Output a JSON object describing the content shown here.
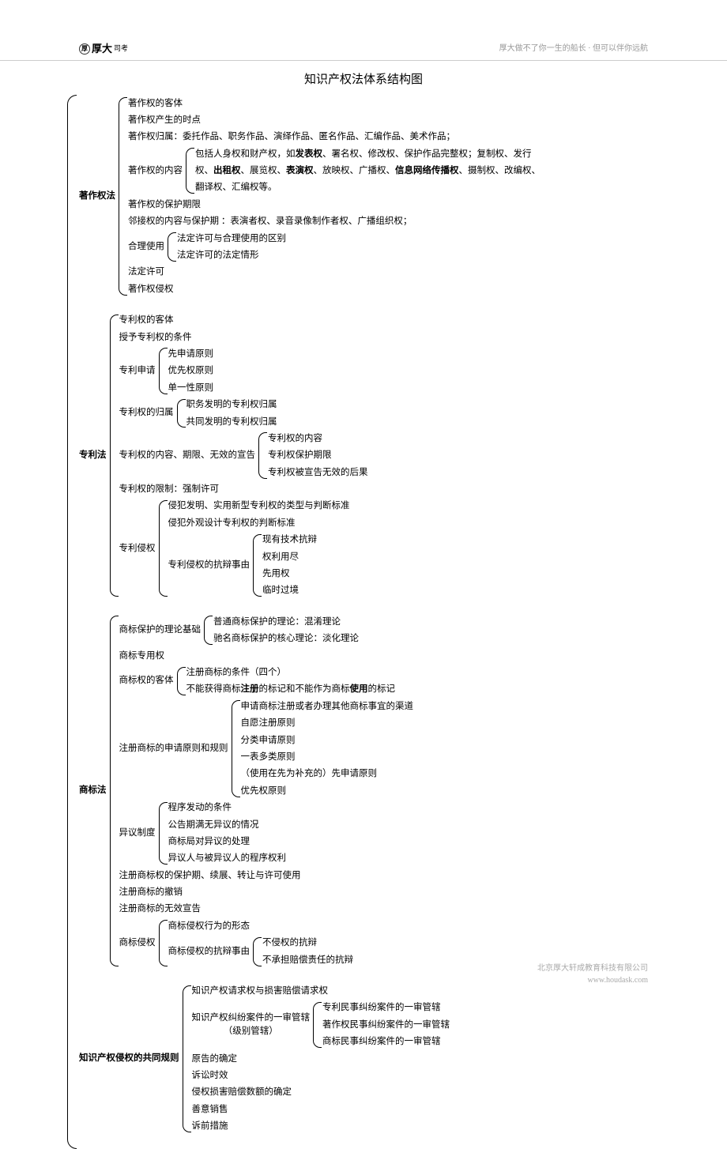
{
  "header": {
    "logo_main": "厚大",
    "logo_sub": "司考",
    "tagline": "厚大做不了你一生的船长 · 但可以伴你远航"
  },
  "title": "知识产权法体系结构图",
  "s1": {
    "label": "著作权法",
    "i1": "著作权的客体",
    "i2": "著作权产生的时点",
    "i3": "著作权归属：委托作品、职务作品、演绎作品、匿名作品、汇编作品、美术作品；",
    "i4_label": "著作权的内容",
    "i4_c1a": "包括人身权和财产权，如",
    "i4_c1b": "发表权",
    "i4_c1c": "、署名权、修改权、保护作品完整权；复制权、发行",
    "i4_c2a": "权、",
    "i4_c2b": "出租权",
    "i4_c2c": "、展览权、",
    "i4_c2d": "表演权",
    "i4_c2e": "、放映权、广播权、",
    "i4_c2f": "信息网络传播权",
    "i4_c2g": "、摄制权、改编权、",
    "i4_c3": "翻译权、汇编权等。",
    "i5": "著作权的保护期限",
    "i6": "邻接权的内容与保护期 ：表演者权、录音录像制作者权、广播组织权；",
    "i7_label": "合理使用",
    "i7_c1": "法定许可与合理使用的区别",
    "i7_c2": "法定许可的法定情形",
    "i8": "法定许可",
    "i9": "著作权侵权"
  },
  "s2": {
    "label": "专利法",
    "i1": "专利权的客体",
    "i2": "授予专利权的条件",
    "i3_label": "专利申请",
    "i3_c1": "先申请原则",
    "i3_c2": "优先权原则",
    "i3_c3": "单一性原则",
    "i4_label": "专利权的归属",
    "i4_c1": "职务发明的专利权归属",
    "i4_c2": "共同发明的专利权归属",
    "i5_label": "专利权的内容、期限、无效的宣告",
    "i5_c1": "专利权的内容",
    "i5_c2": "专利权保护期限",
    "i5_c3": "专利权被宣告无效的后果",
    "i6": "专利权的限制：强制许可",
    "i7_label": "专利侵权",
    "i7_c1": "侵犯发明、实用新型专利权的类型与判断标准",
    "i7_c2": "侵犯外观设计专利权的判断标准",
    "i7_c3_label": "专利侵权的抗辩事由",
    "i7_c3_c1": "现有技术抗辩",
    "i7_c3_c2": "权利用尽",
    "i7_c3_c3": "先用权",
    "i7_c3_c4": "临时过境"
  },
  "s3": {
    "label": "商标法",
    "i1_label": "商标保护的理论基础",
    "i1_c1": "普通商标保护的理论：混淆理论",
    "i1_c2": "驰名商标保护的核心理论：淡化理论",
    "i2": "商标专用权",
    "i3_label": "商标权的客体",
    "i3_c1": "注册商标的条件（四个）",
    "i3_c2a": "不能获得商标",
    "i3_c2b": "注册",
    "i3_c2c": "的标记和不能作为商标",
    "i3_c2d": "使用",
    "i3_c2e": "的标记",
    "i4_label": "注册商标的申请原则和规则",
    "i4_c1": "申请商标注册或者办理其他商标事宜的渠道",
    "i4_c2": "自愿注册原则",
    "i4_c3": "分类申请原则",
    "i4_c4": "一表多类原则",
    "i4_c5": "（使用在先为补充的）先申请原则",
    "i4_c6": "优先权原则",
    "i5_label": "异议制度",
    "i5_c1": "程序发动的条件",
    "i5_c2": "公告期满无异议的情况",
    "i5_c3": "商标局对异议的处理",
    "i5_c4": "异议人与被异议人的程序权利",
    "i6": "注册商标权的保护期、续展、转让与许可使用",
    "i7": "注册商标的撤销",
    "i8": "注册商标的无效宣告",
    "i9_label": "商标侵权",
    "i9_c1": "商标侵权行为的形态",
    "i9_c2_label": "商标侵权的抗辩事由",
    "i9_c2_c1": "不侵权的抗辩",
    "i9_c2_c2": "不承担赔偿责任的抗辩"
  },
  "s4": {
    "label": "知识产权侵权的共同规则",
    "i1": "知识产权请求权与损害赔偿请求权",
    "i2_label_a": "知识产权纠纷案件的一审管辖",
    "i2_label_b": "（级别管辖）",
    "i2_c1": "专利民事纠纷案件的一审管辖",
    "i2_c2": "著作权民事纠纷案件的一审管辖",
    "i2_c3": "商标民事纠纷案件的一审管辖",
    "i3": "原告的确定",
    "i4": "诉讼时效",
    "i5": "侵权损害赔偿数额的确定",
    "i6": "善意销售",
    "i7": "诉前措施"
  },
  "footer": {
    "company": "北京厚大轩成教育科技有限公司",
    "url": "www.houdask.com"
  }
}
